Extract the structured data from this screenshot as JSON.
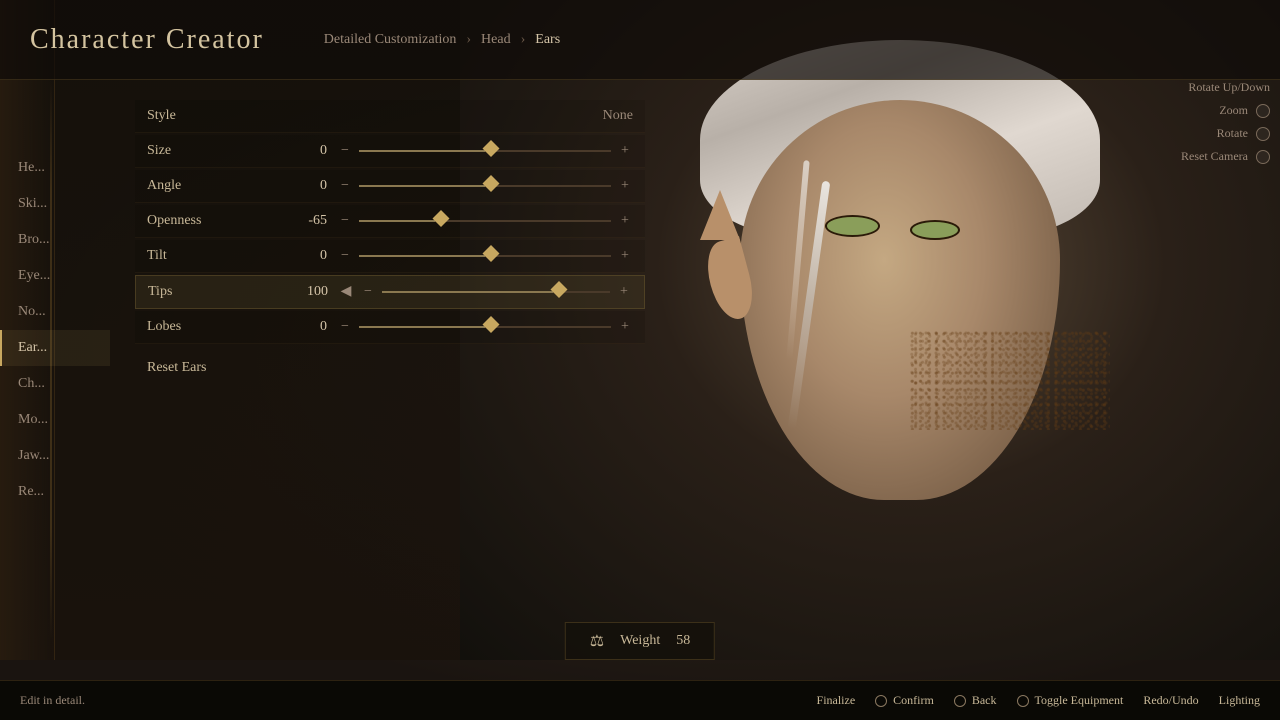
{
  "header": {
    "title": "Character Creator",
    "breadcrumb": {
      "items": [
        "Detailed Customization",
        "Head",
        "Ears"
      ],
      "separators": [
        ">",
        ">"
      ]
    }
  },
  "sidenav": {
    "items": [
      {
        "label": "He...",
        "id": "head",
        "active": false
      },
      {
        "label": "Ski...",
        "id": "skin",
        "active": false
      },
      {
        "label": "Bro...",
        "id": "brow",
        "active": false
      },
      {
        "label": "Eye...",
        "id": "eye",
        "active": false
      },
      {
        "label": "No...",
        "id": "nose",
        "active": false
      },
      {
        "label": "Ear...",
        "id": "ears",
        "active": true
      },
      {
        "label": "Ch...",
        "id": "cheek",
        "active": false
      },
      {
        "label": "Mo...",
        "id": "mouth",
        "active": false
      },
      {
        "label": "Jaw...",
        "id": "jaw",
        "active": false
      },
      {
        "label": "Re...",
        "id": "reset",
        "active": false
      }
    ]
  },
  "controls": {
    "rows": [
      {
        "label": "Style",
        "type": "select",
        "value": "None",
        "hasSlider": false
      },
      {
        "label": "Size",
        "type": "slider",
        "value": "0",
        "sliderPos": 50,
        "highlighted": false
      },
      {
        "label": "Angle",
        "type": "slider",
        "value": "0",
        "sliderPos": 50,
        "highlighted": false
      },
      {
        "label": "Openness",
        "type": "slider",
        "value": "-65",
        "sliderPos": 30,
        "highlighted": false
      },
      {
        "label": "Tilt",
        "type": "slider",
        "value": "0",
        "sliderPos": 50,
        "highlighted": false
      },
      {
        "label": "Tips",
        "type": "slider",
        "value": "100",
        "sliderPos": 75,
        "highlighted": true
      },
      {
        "label": "Lobes",
        "type": "slider",
        "value": "0",
        "sliderPos": 50,
        "highlighted": false
      }
    ],
    "resetButton": "Reset Ears"
  },
  "rightControls": [
    {
      "label": "Rotate Up/Down",
      "hasCircle": false
    },
    {
      "label": "Zoom",
      "hasCircle": true
    },
    {
      "label": "Rotate",
      "hasCircle": true
    },
    {
      "label": "Reset Camera",
      "hasCircle": true
    }
  ],
  "weightIndicator": {
    "icon": "⚖",
    "label": "Weight",
    "value": "58"
  },
  "bottomBar": {
    "hint": "Edit in detail.",
    "actions": [
      {
        "label": "Finalize",
        "hasCircle": false
      },
      {
        "label": "Confirm",
        "hasCircle": true
      },
      {
        "label": "Back",
        "hasCircle": true
      },
      {
        "label": "Toggle Equipment",
        "hasCircle": true
      },
      {
        "label": "Redo/Undo",
        "hasCircle": false
      },
      {
        "label": "Lighting",
        "hasCircle": false
      }
    ]
  }
}
